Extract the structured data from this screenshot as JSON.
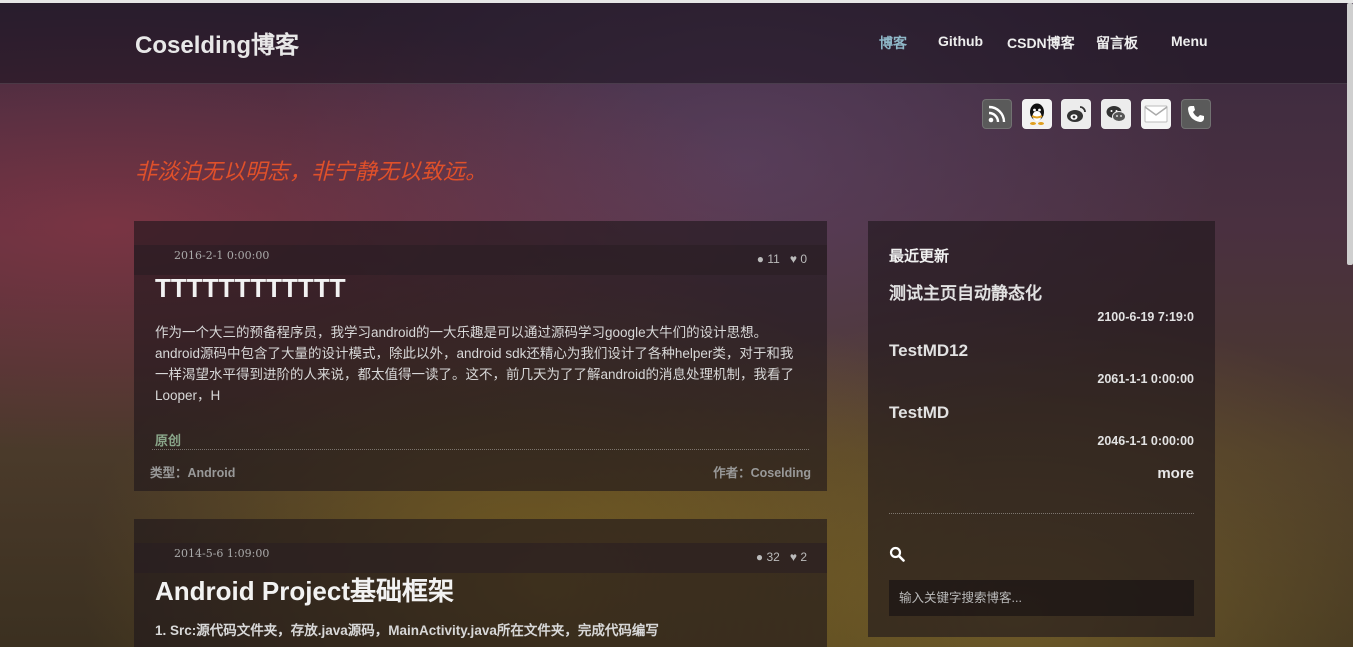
{
  "brand": "Coselding博客",
  "nav": {
    "items": [
      {
        "label": "博客",
        "active": true
      },
      {
        "label": "Github"
      },
      {
        "label": "CSDN博客"
      },
      {
        "label": "留言板"
      },
      {
        "label": "Menu"
      }
    ]
  },
  "social": [
    "rss-icon",
    "qq-icon",
    "weibo-icon",
    "wechat-icon",
    "mail-icon",
    "phone-icon"
  ],
  "motto": "非淡泊无以明志，非宁静无以致远。",
  "posts": [
    {
      "date": "2016-2-1 0:00:00",
      "comments": "11",
      "likes": "0",
      "title": "TTTTTTTTTTTT",
      "excerpt": "作为一个大三的预备程序员，我学习android的一大乐趣是可以通过源码学习google大牛们的设计思想。android源码中包含了大量的设计模式，除此以外，android sdk还精心为我们设计了各种helper类，对于和我一样渴望水平得到进阶的人来说，都太值得一读了。这不，前几天为了了解android的消息处理机制，我看了Looper，H",
      "tag": "原创",
      "category": "类型：Android",
      "author": "作者：Coselding"
    },
    {
      "date": "2014-5-6 1:09:00",
      "comments": "32",
      "likes": "2",
      "title": "Android Project基础框架",
      "excerpt": "1. Src:源代码文件夹，存放.java源码，MainActivity.java所在文件夹，完成代码编写"
    }
  ],
  "sidebar": {
    "heading": "最近更新",
    "items": [
      {
        "title": "测试主页自动静态化",
        "date": "2100-6-19 7:19:0"
      },
      {
        "title": "TestMD12",
        "date": "2061-1-1 0:00:00"
      },
      {
        "title": "TestMD",
        "date": "2046-1-1 0:00:00"
      }
    ],
    "more": "more",
    "search_placeholder": "输入关键字搜索博客..."
  }
}
